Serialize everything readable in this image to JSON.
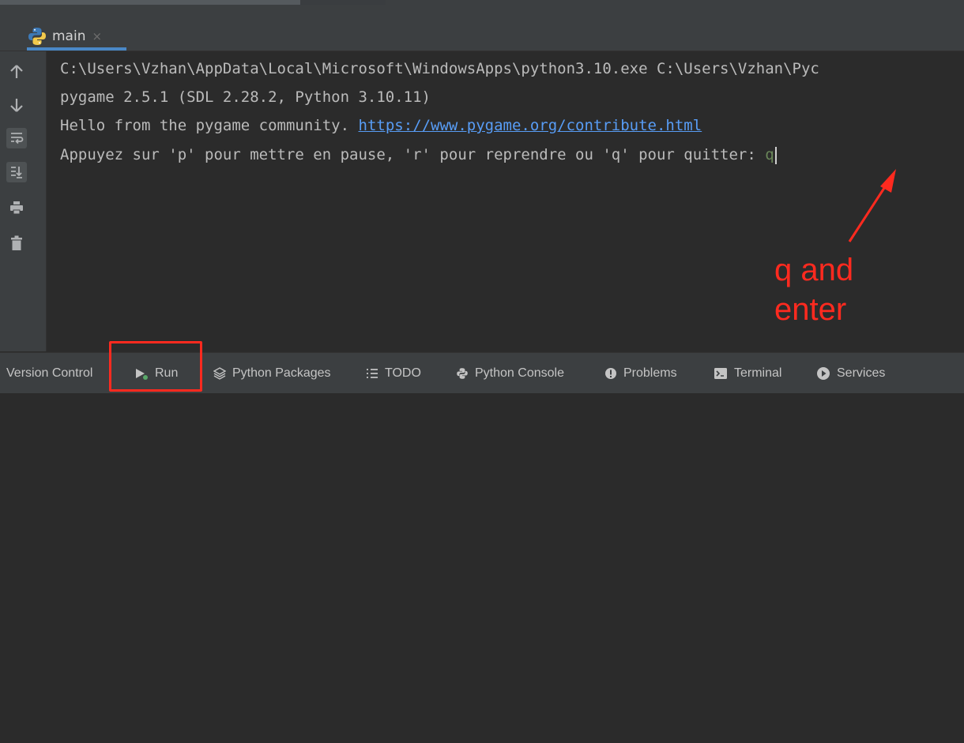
{
  "tab": {
    "label": "main",
    "close_glyph": "×",
    "icon": "python-icon"
  },
  "toolbar": {
    "icons": [
      "arrow-up-icon",
      "arrow-down-icon",
      "soft-wrap-icon",
      "scroll-to-end-icon",
      "print-icon",
      "trash-icon"
    ]
  },
  "console": {
    "line1": "C:\\Users\\Vzhan\\AppData\\Local\\Microsoft\\WindowsApps\\python3.10.exe C:\\Users\\Vzhan\\Pyc",
    "line2": "pygame 2.5.1 (SDL 2.28.2, Python 3.10.11)",
    "line3_text": "Hello from the pygame community. ",
    "line3_link": "https://www.pygame.org/contribute.html",
    "line4": "Appuyez sur 'p' pour mettre en pause, 'r' pour reprendre ou 'q' pour quitter: ",
    "typed_input": "q"
  },
  "annotation": {
    "text": "q and\nenter",
    "color": "#ff2a1f"
  },
  "bottom_bar": {
    "version_control": "Version Control",
    "run": "Run",
    "python_packages": "Python Packages",
    "todo": "TODO",
    "python_console": "Python Console",
    "problems": "Problems",
    "terminal": "Terminal",
    "services": "Services"
  },
  "colors": {
    "background": "#2b2b2b",
    "panel": "#3c3f41",
    "accent": "#4a88c7",
    "link": "#589df6"
  }
}
